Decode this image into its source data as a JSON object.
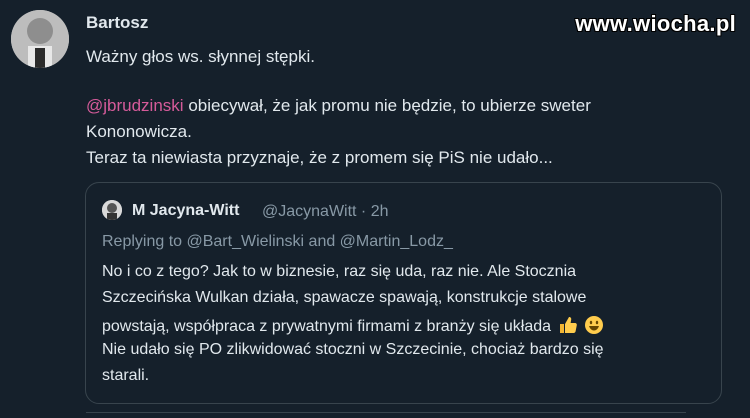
{
  "tweet": {
    "author_name": "Bartosz",
    "lines": [
      "Ważny głos ws. słynnej stępki.",
      "",
      "obiecywał, że jak promu nie będzie, to ubierze sweter",
      "Kononowicza.",
      "Teraz ta niewiasta przyznaje, że z promem się PiS nie udało..."
    ],
    "mention": "@jbrudzinski"
  },
  "watermark": "www.wiocha.pl",
  "quote": {
    "author_name": "M Jacyna-Witt",
    "handle_time": "@JacynaWitt · 2h",
    "replying": "Replying to @Bart_Wielinski and @Martin_Lodz_",
    "lines": [
      "No i co z tego? Jak to w biznesie, raz się uda, raz nie. Ale Stocznia",
      "Szczecińska Wulkan działa, spawacze spawają, konstrukcje stalowe",
      "powstają, współpraca z prywatnymi firmami z branży się układa",
      "Nie udało się PO zlikwidować stoczni w Szczecinie, chociaż bardzo się",
      "starali."
    ],
    "emojis": [
      "thumbs-up-icon",
      "smiley-icon"
    ]
  },
  "colors": {
    "background": "#15202b",
    "mention": "#d55b9a",
    "text": "#e1e8ed",
    "secondary": "#8899a6",
    "border": "#38444d"
  }
}
